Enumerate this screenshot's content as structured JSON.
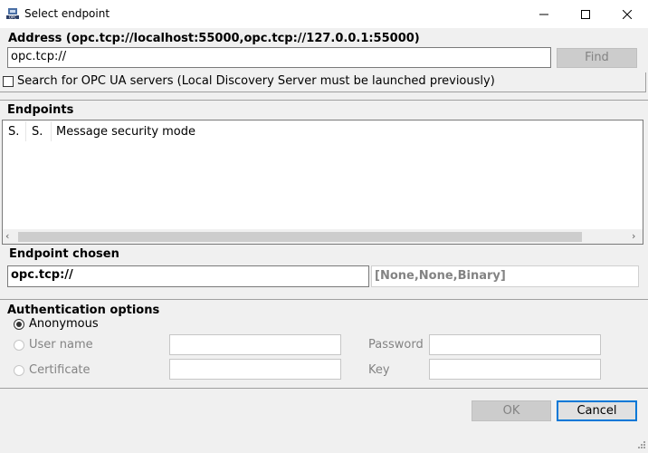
{
  "window": {
    "title": "Select endpoint",
    "icon": "opc-app-icon",
    "minimize_glyph": "—",
    "maximize_glyph": "☐",
    "close_glyph": "✕"
  },
  "address": {
    "label": "Address (opc.tcp://localhost:55000,opc.tcp://127.0.0.1:55000)",
    "value": "opc.tcp://",
    "find_label": "Find"
  },
  "search": {
    "label": "Search for OPC UA servers (Local Discovery Server must be launched previously)",
    "checked": false
  },
  "endpoints": {
    "label": "Endpoints",
    "columns": [
      "S.",
      "S.",
      "Message security mode"
    ],
    "rows": []
  },
  "endpoint_chosen": {
    "label": "Endpoint chosen",
    "value": "opc.tcp://",
    "security": "[None,None,Binary]"
  },
  "auth": {
    "label": "Authentication options",
    "anonymous_label": "Anonymous",
    "username_label": "User name",
    "password_label": "Password",
    "certificate_label": "Certificate",
    "key_label": "Key",
    "selected": "Anonymous"
  },
  "buttons": {
    "ok_label": "OK",
    "cancel_label": "Cancel"
  }
}
